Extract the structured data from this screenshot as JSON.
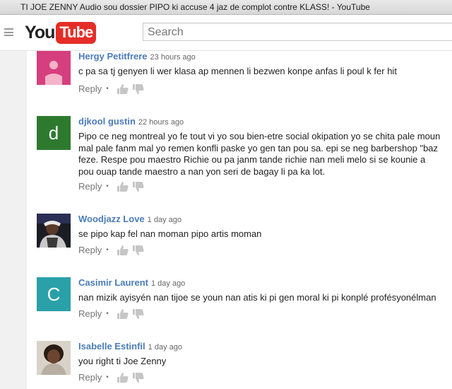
{
  "window": {
    "title": "TI JOE ZENNY Audio sou dossier PIPO ki accuse 4 jaz de complot contre KLASS! - YouTube"
  },
  "masthead": {
    "logo_you": "You",
    "logo_tube": "Tube",
    "search_placeholder": "Search"
  },
  "actions": {
    "reply": "Reply",
    "dot": "•"
  },
  "comments": [
    {
      "author": "Hergy Petitfrere",
      "time": "23 hours ago",
      "text": "c pa sa tj genyen li wer klasa ap mennen li bezwen konpe anfas li poul k fer hit",
      "avatar": {
        "type": "default-user",
        "color": "#d63f7e"
      }
    },
    {
      "author": "djkool gustin",
      "time": "22 hours ago",
      "text": "Pipo ce neg montreal yo fe tout vi yo sou bien-etre social okipation yo se chita pale moun mal pale fanm mal yo remen konfli paske yo gen tan pou sa. epi se neg barbershop \"baz feze. Respe pou maestro Richie ou pa janm tande richie nan meli melo si se kounie a pou ouap tande maestro a nan yon seri de bagay li pa ka lot.",
      "avatar": {
        "type": "letter",
        "letter": "d",
        "color": "#2d7a2f"
      }
    },
    {
      "author": "Woodjazz Love",
      "time": "1 day ago",
      "text": "se pipo kap fel nan moman pipo artis moman",
      "avatar": {
        "type": "photo"
      }
    },
    {
      "author": "Casimir Laurent",
      "time": "1 day ago",
      "text": "nan mizik ayisyén nan tijoe se youn nan atis ki pi gen moral ki pi konplé profésyonélman",
      "avatar": {
        "type": "letter",
        "letter": "C",
        "color": "#2aa0a8"
      }
    },
    {
      "author": "Isabelle Estinfil",
      "time": "1 day ago",
      "text": "you right ti Joe Zenny",
      "avatar": {
        "type": "photo"
      }
    }
  ]
}
